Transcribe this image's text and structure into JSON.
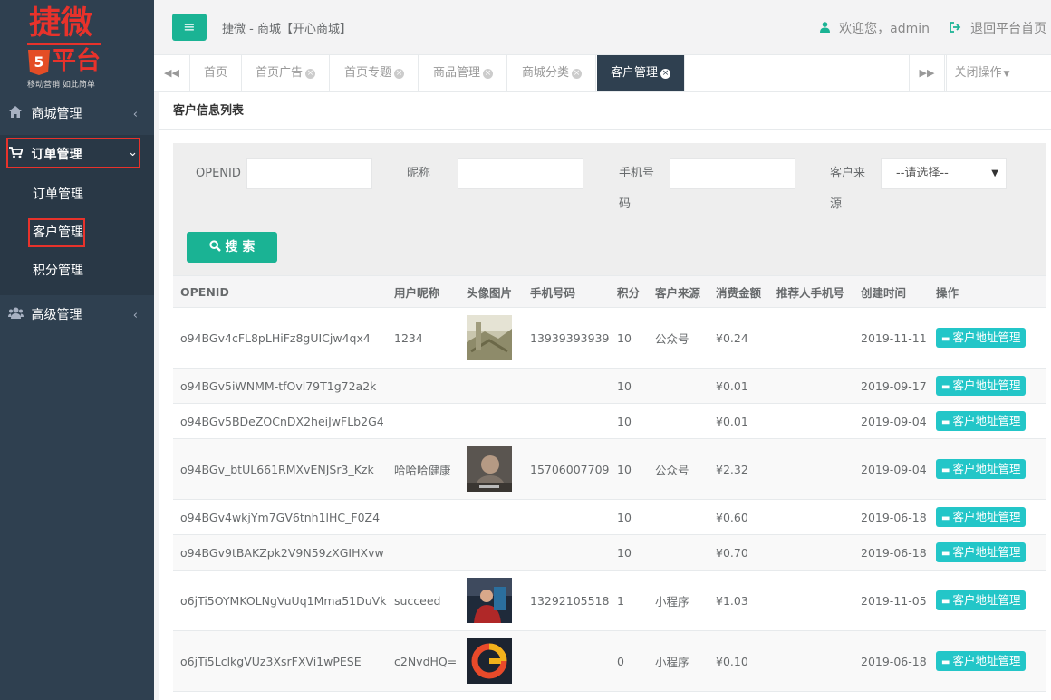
{
  "logo": {
    "brand": "捷微",
    "badge": "5",
    "platform": "平台",
    "slogan": "移动营销 如此简单"
  },
  "sidebar": {
    "groups": [
      {
        "label": "商城管理",
        "icon": "home-icon",
        "arrow": "‹"
      },
      {
        "label": "订单管理",
        "icon": "cart-icon",
        "arrow": "⌄"
      },
      {
        "label": "高级管理",
        "icon": "users-icon",
        "arrow": "‹"
      }
    ],
    "sub_items": [
      "订单管理",
      "客户管理",
      "积分管理"
    ]
  },
  "header": {
    "menu_icon": "≡",
    "breadcrumb": "捷微 - 商城【开心商城】",
    "welcome": "欢迎您，admin",
    "logout": "退回平台首页"
  },
  "tabs": {
    "items": [
      "首页",
      "首页广告",
      "首页专题",
      "商品管理",
      "商城分类",
      "客户管理"
    ],
    "close_ops": "关闭操作"
  },
  "panel": {
    "title": "客户信息列表"
  },
  "search": {
    "labels": {
      "openid": "OPENID",
      "nickname": "昵称",
      "phone_1": "手机号",
      "phone_2": "码",
      "source_1": "客户来",
      "source_2": "源"
    },
    "source_select": "--请选择--",
    "button": "搜 索"
  },
  "table": {
    "headers": [
      "OPENID",
      "用户昵称",
      "头像图片",
      "手机号码",
      "积分",
      "客户来源",
      "消费金额",
      "推荐人手机号",
      "创建时间",
      "操作"
    ],
    "action_label": "客户地址管理",
    "rows": [
      {
        "openid": "o94BGv4cFL8pLHiFz8gUICjw4qx4",
        "nickname": "1234",
        "avatar": "photo-1",
        "phone": "13939393939",
        "points": "10",
        "source": "公众号",
        "amount": "¥0.24",
        "referrer": "",
        "created": "2019-11-11"
      },
      {
        "openid": "o94BGv5iWNMM-tfOvl79T1g72a2k",
        "nickname": "",
        "avatar": "",
        "phone": "",
        "points": "10",
        "source": "",
        "amount": "¥0.01",
        "referrer": "",
        "created": "2019-09-17"
      },
      {
        "openid": "o94BGv5BDeZOCnDX2heiJwFLb2G4",
        "nickname": "",
        "avatar": "",
        "phone": "",
        "points": "10",
        "source": "",
        "amount": "¥0.01",
        "referrer": "",
        "created": "2019-09-04"
      },
      {
        "openid": "o94BGv_btUL661RMXvENJSr3_Kzk",
        "nickname": "哈哈哈健康",
        "avatar": "photo-2",
        "phone": "15706007709",
        "points": "10",
        "source": "公众号",
        "amount": "¥2.32",
        "referrer": "",
        "created": "2019-09-04"
      },
      {
        "openid": "o94BGv4wkjYm7GV6tnh1lHC_F0Z4",
        "nickname": "",
        "avatar": "",
        "phone": "",
        "points": "10",
        "source": "",
        "amount": "¥0.60",
        "referrer": "",
        "created": "2019-06-18"
      },
      {
        "openid": "o94BGv9tBAKZpk2V9N59zXGIHXvw",
        "nickname": "",
        "avatar": "",
        "phone": "",
        "points": "10",
        "source": "",
        "amount": "¥0.70",
        "referrer": "",
        "created": "2019-06-18"
      },
      {
        "openid": "o6jTi5OYMKOLNgVuUq1Mma51DuVk",
        "nickname": "succeed",
        "avatar": "photo-3",
        "phone": "13292105518",
        "points": "1",
        "source": "小程序",
        "amount": "¥1.03",
        "referrer": "",
        "created": "2019-11-05"
      },
      {
        "openid": "o6jTi5LclkgVUz3XsrFXVi1wPESE",
        "nickname": "c2NvdHQ=",
        "avatar": "logo-4",
        "phone": "",
        "points": "0",
        "source": "小程序",
        "amount": "¥0.10",
        "referrer": "",
        "created": "2019-06-18"
      }
    ]
  },
  "colors": {
    "sidebar": "#2f4050",
    "primary": "#1ab394",
    "info": "#23c6c8",
    "highlight": "#e8322b"
  }
}
